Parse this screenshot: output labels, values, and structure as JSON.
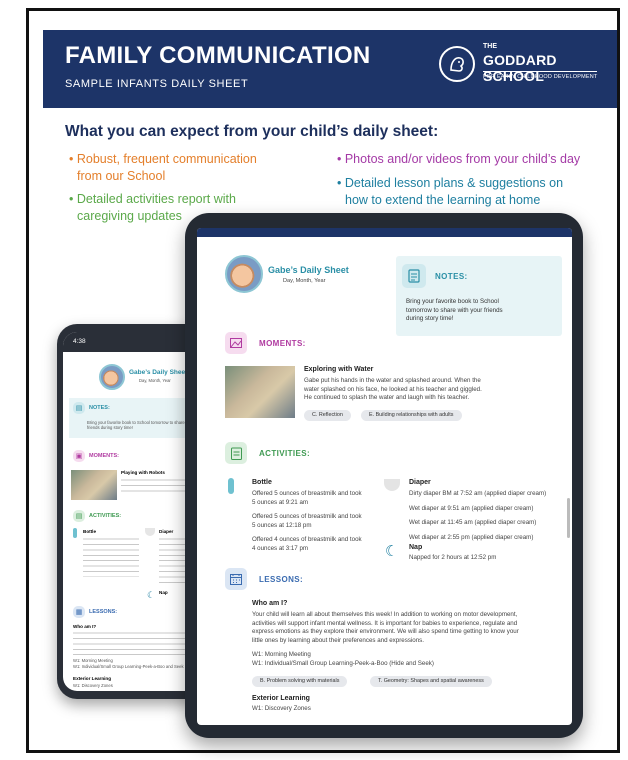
{
  "banner": {
    "title": "FAMILY COMMUNICATION",
    "subtitle": "SAMPLE INFANTS DAILY SHEET",
    "logo": {
      "the": "THE",
      "name": "GODDARD SCHOOL",
      "tagline": "FOR EARLY CHILDHOOD DEVELOPMENT"
    }
  },
  "headline": "What you can expect from your child’s daily sheet:",
  "bullets": [
    {
      "text": "• Robust, frequent communication",
      "text2": "from our School",
      "color": "#e47f2b"
    },
    {
      "text": "• Detailed activities report with",
      "text2": "caregiving updates",
      "color": "#5ba94a"
    },
    {
      "text": "• Photos and/or videos from your child’s day",
      "color": "#a43aa6"
    },
    {
      "text": "• Detailed lesson plans & suggestions on",
      "text2": "how to extend the learning at home",
      "color": "#1e7fa0"
    }
  ],
  "tablet": {
    "sheet_title": "Gabe’s Daily Sheet",
    "sheet_date": "Day, Month, Year",
    "notes": {
      "title": "NOTES:",
      "body1": "Bring your favorite book to School",
      "body2": "tomorrow to share with your friends",
      "body3": "during story time!"
    },
    "moments": {
      "title": "MOMENTS:",
      "item_title": "Exploring with Water",
      "line1": "Gabe put his hands in the water and splashed around. When the",
      "line2": "water splashed on his face, he looked at his teacher and giggled.",
      "line3": "He continued to splash the water and laugh with his teacher.",
      "tag1": "C. Reflection",
      "tag2": "E. Building relationships with adults"
    },
    "activities": {
      "title": "ACTIVITIES:",
      "bottle": {
        "title": "Bottle",
        "e1a": "Offered 5 ounces of breastmilk and took",
        "e1b": "5 ounces at 9:21 am",
        "e2a": "Offered 5 ounces of breastmilk and took",
        "e2b": "5 ounces at 12:18 pm",
        "e3a": "Offered 4 ounces of breastmilk and took",
        "e3b": "4 ounces at 3:17 pm"
      },
      "diaper": {
        "title": "Diaper",
        "d1": "Dirty diaper BM at 7:52 am (applied diaper cream)",
        "d2": "Wet diaper at 9:51 am (applied diaper cream)",
        "d3": "Wet diaper at 11:45 am (applied diaper cream)",
        "d4": "Wet diaper at 2:55 pm (applied diaper cream)"
      },
      "nap": {
        "title": "Nap",
        "n1": "Napped for 2 hours at 12:52 pm"
      }
    },
    "lessons": {
      "title": "LESSONS:",
      "who": "Who am I?",
      "p1": "Your child will learn all about themselves this week! In addition to working on motor development,",
      "p2": "activities will support infant mental wellness. It is important for babies to experience, regulate and",
      "p3": "express emotions as they explore their environment. We will also spend time getting to know your",
      "p4": "little ones by learning about their preferences and expressions.",
      "w1": "W1: Morning Meeting",
      "w2": "W1: Individual/Small Group Learning-Peek-a-Boo (Hide and Seek)",
      "tag1": "B. Problem solving with materials",
      "tag2": "T. Geometry: Shapes and spatial awareness",
      "ext": "Exterior Learning",
      "ext1": "W1: Discovery Zones"
    }
  },
  "phone": {
    "time": "4:38",
    "signal": "all",
    "sheet_title": "Gabe’s Daily Sheet",
    "sheet_date": "Day, Month, Year",
    "notes_title": "NOTES:",
    "notes_body1": "Bring your favorite book to School tomorrow to share with your",
    "notes_body2": "friends during story time!",
    "moments_title": "MOMENTS:",
    "moment_item": "Playing with Robots",
    "activities_title": "ACTIVITIES:",
    "bottle": "Bottle",
    "diaper": "Diaper",
    "nap": "Nap",
    "lessons_title": "LESSONS:",
    "who": "Who am I?",
    "w1": "W1: Morning Meeting",
    "w2": "W1: Individual/Small Group Learning-Peek-a-Boo and Seek",
    "ext": "Exterior Learning",
    "ext1": "W1: Discovery Zones"
  },
  "colors": {
    "navy": "#1d3468",
    "teal": "#2a8fa6",
    "magenta": "#b03aa0",
    "green": "#3f9a52",
    "orange": "#e47f2b"
  }
}
